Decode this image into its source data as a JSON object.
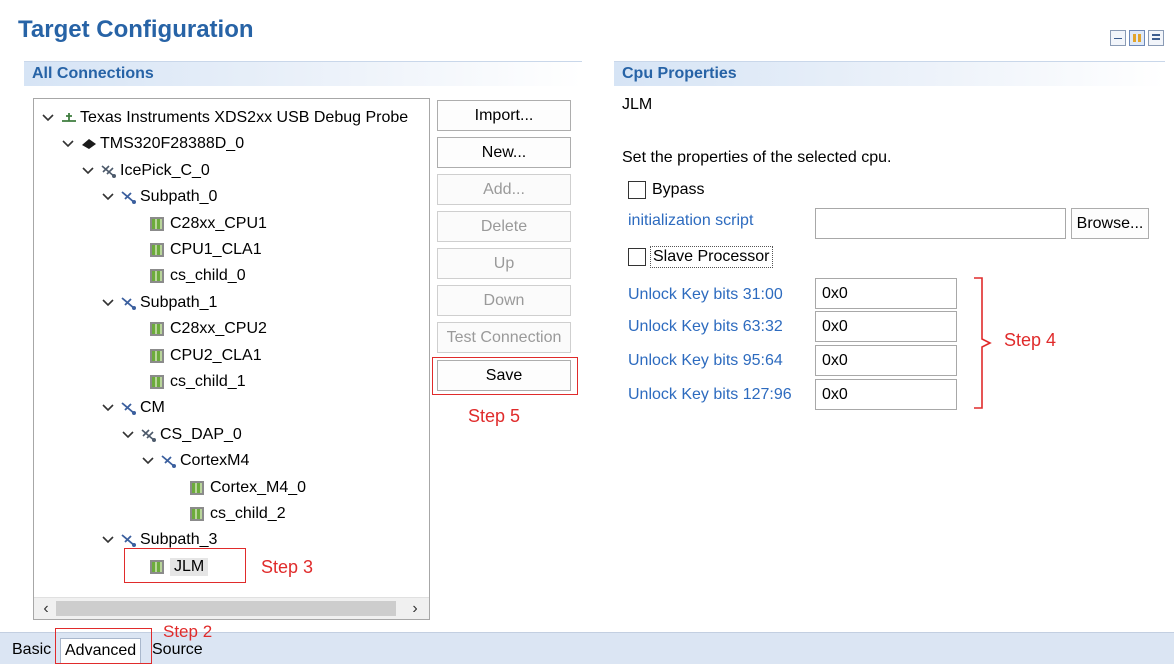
{
  "header": {
    "title": "Target Configuration",
    "view_icons": [
      "collapse-icon",
      "grid-view-icon",
      "list-view-icon"
    ]
  },
  "connections": {
    "header": "All Connections",
    "tree": [
      {
        "label": "Texas Instruments XDS2xx USB Debug Probe",
        "icon": "probe-icon",
        "expanded": true
      },
      {
        "label": "TMS320F28388D_0",
        "icon": "device-icon",
        "expanded": true
      },
      {
        "label": "IcePick_C_0",
        "icon": "router-icon",
        "expanded": true
      },
      {
        "label": "Subpath_0",
        "icon": "subpath-icon",
        "expanded": true
      },
      {
        "label": "C28xx_CPU1",
        "icon": "cpu-chip-icon"
      },
      {
        "label": "CPU1_CLA1",
        "icon": "cpu-chip-icon"
      },
      {
        "label": "cs_child_0",
        "icon": "cpu-chip-icon"
      },
      {
        "label": "Subpath_1",
        "icon": "subpath-icon",
        "expanded": true
      },
      {
        "label": "C28xx_CPU2",
        "icon": "cpu-chip-icon"
      },
      {
        "label": "CPU2_CLA1",
        "icon": "cpu-chip-icon"
      },
      {
        "label": "cs_child_1",
        "icon": "cpu-chip-icon"
      },
      {
        "label": "CM",
        "icon": "subpath-icon",
        "expanded": true
      },
      {
        "label": "CS_DAP_0",
        "icon": "router-icon",
        "expanded": true
      },
      {
        "label": "CortexM4",
        "icon": "subpath-icon",
        "expanded": true
      },
      {
        "label": "Cortex_M4_0",
        "icon": "cpu-chip-icon"
      },
      {
        "label": "cs_child_2",
        "icon": "cpu-chip-icon"
      },
      {
        "label": "Subpath_3",
        "icon": "subpath-icon",
        "expanded": true
      },
      {
        "label": "JLM",
        "icon": "cpu-chip-icon",
        "selected": true
      }
    ]
  },
  "buttons": {
    "import": "Import...",
    "new": "New...",
    "add": "Add...",
    "delete": "Delete",
    "up": "Up",
    "down": "Down",
    "test_connection": "Test Connection",
    "save": "Save"
  },
  "cpu_properties": {
    "header": "Cpu Properties",
    "cpu_name": "JLM",
    "description": "Set the properties of the selected cpu.",
    "bypass_label": "Bypass",
    "bypass_checked": false,
    "init_script_label": "initialization script",
    "init_script_value": "",
    "browse_label": "Browse...",
    "slave_label": "Slave Processor",
    "slave_checked": false,
    "unlock_keys": [
      {
        "label": "Unlock Key bits 31:00",
        "value": "0x0"
      },
      {
        "label": "Unlock Key bits 63:32",
        "value": "0x0"
      },
      {
        "label": "Unlock Key bits 95:64",
        "value": "0x0"
      },
      {
        "label": "Unlock Key bits 127:96",
        "value": "0x0"
      }
    ]
  },
  "annotations": {
    "step2": "Step 2",
    "step3": "Step 3",
    "step4": "Step 4",
    "step5": "Step 5",
    "color": "#e02b2b"
  },
  "tabs": [
    "Basic",
    "Advanced",
    "Source"
  ],
  "active_tab": "Advanced"
}
